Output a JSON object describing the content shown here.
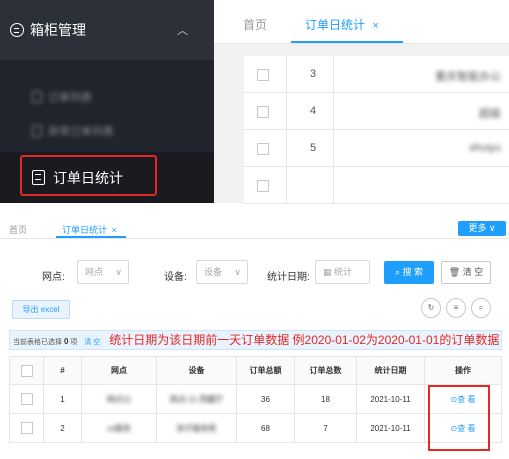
{
  "sidebar": {
    "group_label": "箱柜管理",
    "items": [
      {
        "label": "订单列表"
      },
      {
        "label": "异常订单列表"
      }
    ],
    "active_label": "订单日统计"
  },
  "top_tabs": {
    "home": "首页",
    "active": "订单日统计",
    "close": "×"
  },
  "top_table": {
    "rows": [
      {
        "num": "3",
        "value": "重庆智能办公"
      },
      {
        "num": "4",
        "value": "超级"
      },
      {
        "num": "5",
        "value": "shuiyu"
      },
      {
        "num": "",
        "value": ""
      }
    ]
  },
  "tabs": {
    "home": "首页",
    "active": "订单日统计",
    "close": "×",
    "more": "更多 ∨"
  },
  "filters": {
    "point_label": "网点:",
    "point_placeholder": "网点",
    "device_label": "设备:",
    "device_placeholder": "设备",
    "date_label": "统计日期:",
    "date_placeholder": "统计",
    "search_btn": "搜 索",
    "clear_btn": "清 空"
  },
  "toolbar": {
    "export": "导出 excel"
  },
  "info": {
    "prefix": "当前表格已选择",
    "count": "0",
    "suffix": "项",
    "clear": "清 空",
    "note": "统计日期为该日期前一天订单数据 例2020-01-02为2020-01-01的订单数据"
  },
  "table": {
    "headers": [
      "#",
      "网点",
      "设备",
      "订单总额",
      "订单总数",
      "统计日期",
      "操作"
    ],
    "rows": [
      {
        "num": "1",
        "point": "网点11",
        "device": "网点-11 西藏厅",
        "amount": "36",
        "count": "18",
        "date": "2021-10-11",
        "action": "查 看"
      },
      {
        "num": "2",
        "point": "xx服务",
        "device": "快子服务柜",
        "amount": "68",
        "count": "7",
        "date": "2021-10-11",
        "action": "查 看"
      }
    ]
  }
}
